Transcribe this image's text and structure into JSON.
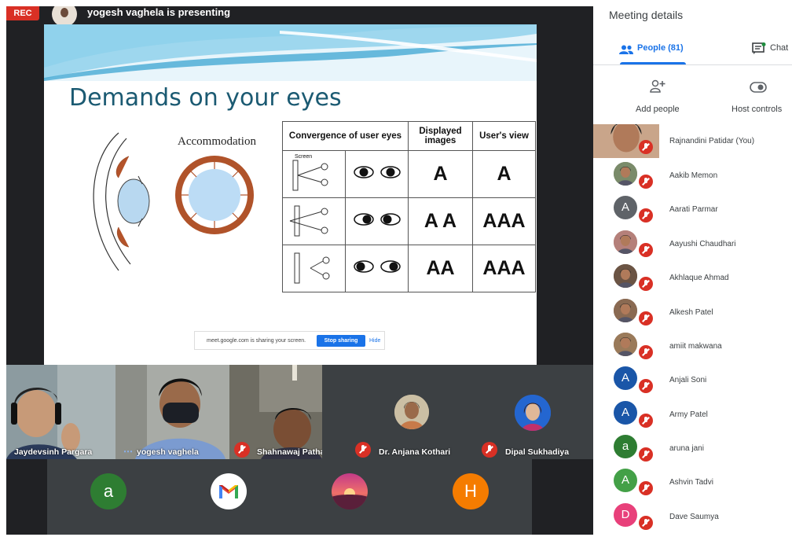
{
  "stage": {
    "rec_label": "REC",
    "presenting_text": "yogesh vaghela is presenting"
  },
  "slide": {
    "title": "Demands on your eyes",
    "accommodation_label": "Accommodation",
    "table": {
      "headers": [
        "Convergence of user eyes",
        "Displayed images",
        "User's view"
      ],
      "screen_label": "Screen",
      "rows": [
        {
          "displayed": "A",
          "view": "A"
        },
        {
          "displayed": "A A",
          "view": "AAA"
        },
        {
          "displayed": "AA",
          "view": "AAA"
        }
      ]
    }
  },
  "share_bar": {
    "text": "meet.google.com is sharing your screen.",
    "stop_label": "Stop sharing",
    "hide_label": "Hide"
  },
  "tiles_row1": [
    {
      "name": "Jaydevsinh Pargara"
    },
    {
      "name": "yogesh vaghela"
    },
    {
      "name": "Shahnawaj Pathan"
    },
    {
      "name": "Dr. Anjana Kothari"
    },
    {
      "name": "Dipal Sukhadiya"
    }
  ],
  "tiles_row2": [
    {
      "initial": "a",
      "color": "#2e7d32"
    },
    {
      "initial": "M",
      "color": "#ffffff"
    },
    {
      "initial": "",
      "color": "#d94f6b"
    },
    {
      "initial": "H",
      "color": "#f57c00"
    }
  ],
  "panel": {
    "title": "Meeting details",
    "tab_people": "People (81)",
    "tab_chat": "Chat",
    "add_people": "Add people",
    "host_controls": "Host controls",
    "people": [
      {
        "name": "Rajnandini Patidar (You)",
        "initial": "",
        "color": "#c9a58a"
      },
      {
        "name": "Aakib Memon",
        "initial": "",
        "color": "#7a8b6a"
      },
      {
        "name": "Aarati Parmar",
        "initial": "A",
        "color": "#5f6368"
      },
      {
        "name": "Aayushi Chaudhari",
        "initial": "",
        "color": "#b5807a"
      },
      {
        "name": "Akhlaque Ahmad",
        "initial": "",
        "color": "#6b5444"
      },
      {
        "name": "Alkesh Patel",
        "initial": "",
        "color": "#8a6a52"
      },
      {
        "name": "amiit makwana",
        "initial": "",
        "color": "#9a7a5a"
      },
      {
        "name": "Anjali Soni",
        "initial": "A",
        "color": "#1a56a8"
      },
      {
        "name": "Army Patel",
        "initial": "A",
        "color": "#1a56a8"
      },
      {
        "name": "aruna jani",
        "initial": "a",
        "color": "#2e7d32"
      },
      {
        "name": "Ashvin Tadvi",
        "initial": "A",
        "color": "#43a047"
      },
      {
        "name": "Dave Saumya",
        "initial": "D",
        "color": "#e8407a"
      }
    ]
  }
}
